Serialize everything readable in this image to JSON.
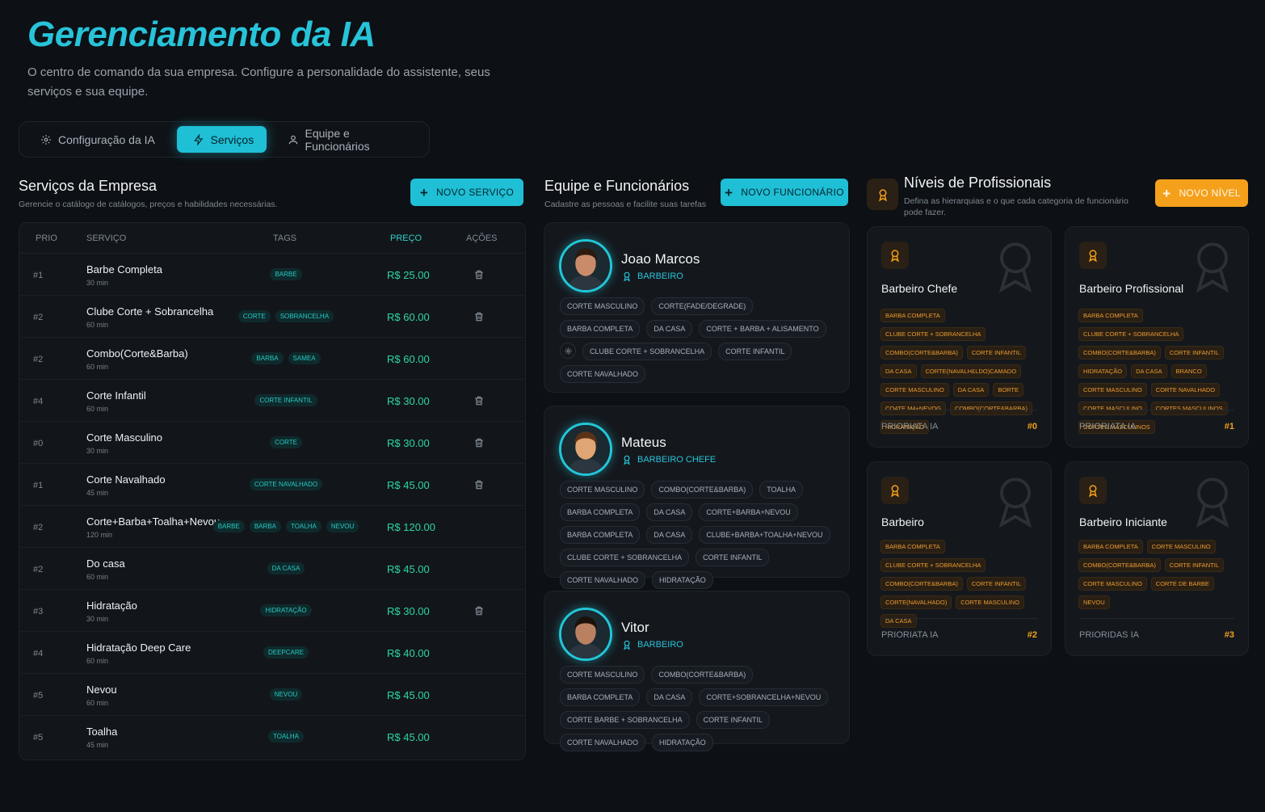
{
  "header": {
    "title": "Gerenciamento da IA",
    "subtitle": "O centro de comando da sua empresa. Configure a personalidade do assistente, seus serviços e sua equipe."
  },
  "tabs": [
    {
      "label": "Configuração da IA",
      "icon": "gear-icon"
    },
    {
      "label": "Serviços",
      "icon": "sparkle-icon",
      "active": true
    },
    {
      "label": "Equipe e Funcionários",
      "icon": "user-icon"
    }
  ],
  "services": {
    "title": "Serviços da Empresa",
    "subtitle": "Gerencie o catálogo de catálogos, preços e habilidades necessárias.",
    "new_button": "NOVO SERVIÇO",
    "columns": {
      "prio": "PRIO",
      "service": "SERVIÇO",
      "tags": "TAGS",
      "price": "PREÇO",
      "actions": "AÇÕES"
    },
    "rows": [
      {
        "prio": "#1",
        "name": "Barbe Completa",
        "duration": "30 min",
        "tags": [
          "BARBE"
        ],
        "price": "R$ 25.00",
        "delete": true
      },
      {
        "prio": "#2",
        "name": "Clube Corte + Sobrancelha",
        "duration": "60 min",
        "tags": [
          "CORTE",
          "SOBRANCELHA"
        ],
        "price": "R$ 60.00",
        "delete": true
      },
      {
        "prio": "#2",
        "name": "Combo(Corte&Barba)",
        "duration": "60 min",
        "tags": [
          "BARBA",
          "SAMEA"
        ],
        "price": "R$ 60.00",
        "delete": false
      },
      {
        "prio": "#4",
        "name": "Corte Infantil",
        "duration": "60 min",
        "tags": [
          "CORTE INFANTIL"
        ],
        "price": "R$ 30.00",
        "delete": true
      },
      {
        "prio": "#0",
        "name": "Corte Masculino",
        "duration": "30 min",
        "tags": [
          "CORTE"
        ],
        "price": "R$ 30.00",
        "delete": true
      },
      {
        "prio": "#1",
        "name": "Corte Navalhado",
        "duration": "45 min",
        "tags": [
          "CORTE NAVALHADO"
        ],
        "price": "R$ 45.00",
        "delete": true
      },
      {
        "prio": "#2",
        "name": "Corte+Barba+Toalha+Nevou",
        "duration": "120 min",
        "tags": [
          "BARBE",
          "BARBA",
          "TOALHA",
          "NEVOU"
        ],
        "price": "R$ 120.00",
        "delete": false
      },
      {
        "prio": "#2",
        "name": "Do casa",
        "duration": "60 min",
        "tags": [
          "DA CASA"
        ],
        "price": "R$ 45.00",
        "delete": false
      },
      {
        "prio": "#3",
        "name": "Hidratação",
        "duration": "30 min",
        "tags": [
          "HIDRATAÇÃO"
        ],
        "price": "R$ 30.00",
        "delete": true
      },
      {
        "prio": "#4",
        "name": "Hidratação Deep Care",
        "duration": "60 min",
        "tags": [
          "DEEPCARE"
        ],
        "price": "R$ 40.00",
        "delete": false
      },
      {
        "prio": "#5",
        "name": "Nevou",
        "duration": "60 min",
        "tags": [
          "NEVOU"
        ],
        "price": "R$ 45.00",
        "delete": false
      },
      {
        "prio": "#5",
        "name": "Toalha",
        "duration": "45 min",
        "tags": [
          "TOALHA"
        ],
        "price": "R$ 45.00",
        "delete": false
      }
    ]
  },
  "team": {
    "title": "Equipe e Funcionários",
    "subtitle": "Cadastre as pessoas e facilite suas tarefas",
    "new_button": "NOVO FUNCIONÁRIO",
    "members": [
      {
        "name": "Joao Marcos",
        "role": "BARBEIRO",
        "skin": "#c98b6a",
        "hair": "#2a1a10",
        "skills": [
          "CORTE MASCULINO",
          "CORTE(FADE/DEGRADE)",
          "BARBA COMPLETA",
          "DA CASA",
          "CORTE + BARBA + ALISAMENTO",
          "CLUBE CORTE + SOBRANCELHA",
          "CORTE INFANTIL",
          "CORTE NAVALHADO"
        ]
      },
      {
        "name": "Mateus",
        "role": "BARBEIRO CHEFE",
        "skin": "#e0a574",
        "hair": "#5a3218",
        "skills": [
          "CORTE MASCULINO",
          "COMBO(CORTE&BARBA)",
          "TOALHA",
          "BARBA COMPLETA",
          "DA CASA",
          "CORTE+BARBA+NEVOU",
          "BARBA COMPLETA",
          "DA CASA",
          "CLUBE+BARBA+TOALHA+NEVOU",
          "CLUBE CORTE + SOBRANCELHA",
          "CORTE INFANTIL",
          "CORTE NAVALHADO",
          "HIDRATAÇÃO"
        ]
      },
      {
        "name": "Vitor",
        "role": "BARBEIRO",
        "skin": "#b98162",
        "hair": "#1b120c",
        "skills": [
          "CORTE MASCULINO",
          "COMBO(CORTE&BARBA)",
          "BARBA COMPLETA",
          "DA CASA",
          "CORTE+SOBRANCELHA+NEVOU",
          "CORTE BARBE + SOBRANCELHA",
          "CORTE INFANTIL",
          "CORTE NAVALHADO",
          "HIDRATAÇÃO"
        ]
      }
    ]
  },
  "levels": {
    "title": "Níveis de Profissionais",
    "subtitle": "Defina as hierarquias e o que cada categoria de funcionário pode fazer.",
    "new_button": "NOVO NÍVEL",
    "items": [
      {
        "name": "Barbeiro Chefe",
        "footer_label": "PRIORIATA IA",
        "priority": "#0",
        "tags": [
          "BARBA COMPLETA",
          "CLUBE CORTE + SOBRANCELHA",
          "COMBO(CORTE&BARBA)",
          "CORTE INFANTIL",
          "DA CASA",
          "CORTE(NAVALH£LDO)CAMADO",
          "CORTE MASCULINO",
          "DA CASA",
          "BORTE",
          "CO4TE.M4+NEVOG",
          "COMBO(CORTE&BARBA)",
          "HIDRATAÇÃO"
        ]
      },
      {
        "name": "Barbeiro Profissional",
        "footer_label": "PRIORIATA IA",
        "priority": "#1",
        "tags": [
          "BARBA COMPLETA",
          "CLUBE CORTE + SOBRANCELHA",
          "COMBO(CORTE&BARBA)",
          "CORTE INFANTIL",
          "HIDRATAÇÃO",
          "DA CASA",
          "BRANCO",
          "CORTE MASCULINO",
          "CORTE NAVALHADO",
          "CORTE MASCULINO",
          "CORTES MASCULINOS",
          "CORTES MASCULINOS"
        ]
      },
      {
        "name": "Barbeiro",
        "footer_label": "PRIORIATA IA",
        "priority": "#2",
        "tags": [
          "BARBA COMPLETA",
          "CLUBE CORTE + SOBRANCELHA",
          "COMBO(CORTE&BARBA)",
          "CORTE INFANTIL",
          "CORTE(NAVALHADO)",
          "CORTE MASCULINO",
          "DA CASA"
        ]
      },
      {
        "name": "Barbeiro Iniciante",
        "footer_label": "PRIORIDAS IA",
        "priority": "#3",
        "tags": [
          "BARBA COMPLETA",
          "CORTE MASCULINO",
          "COMBO(CORTE&BARBA)",
          "CORTE INFANTIL",
          "CORTE MASCULINO",
          "CORTE DE BARBE",
          "NEVOU"
        ]
      }
    ]
  },
  "colors": {
    "accent": "#1fbfd6",
    "price": "#2fd4a6",
    "level_accent": "#f5a01a",
    "background": "#0d1014"
  }
}
